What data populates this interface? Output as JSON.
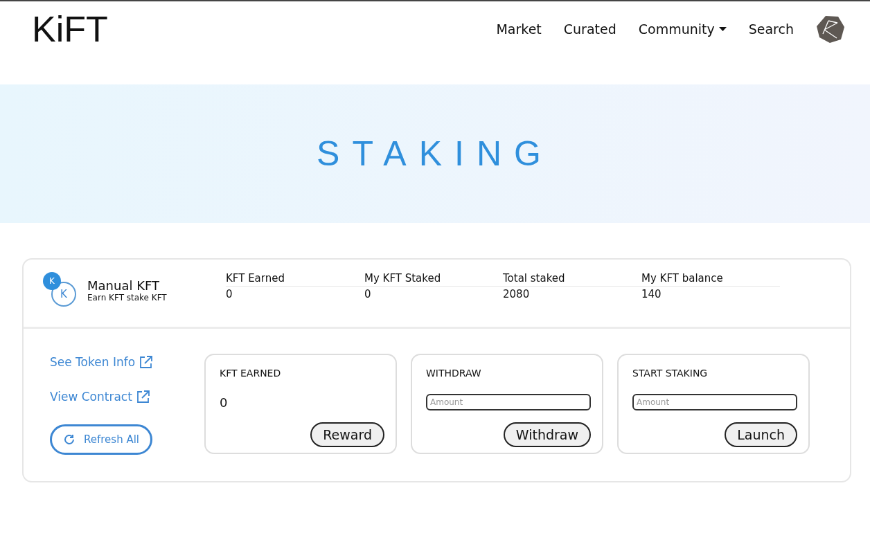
{
  "brand": "KiFT",
  "nav": [
    {
      "label": "Market",
      "dropdown": false
    },
    {
      "label": "Curated",
      "dropdown": false
    },
    {
      "label": "Community",
      "dropdown": true
    },
    {
      "label": "Search",
      "dropdown": false
    }
  ],
  "hero": {
    "title": "STAKING"
  },
  "pool": {
    "badge": "K",
    "token": "K",
    "name": "Manual KFT",
    "subtitle": "Earn KFT stake KFT",
    "stats": [
      {
        "label": "KFT Earned",
        "value": "0"
      },
      {
        "label": "My KFT Staked",
        "value": "0"
      },
      {
        "label": "Total staked",
        "value": "2080"
      },
      {
        "label": "My KFT balance",
        "value": "140"
      }
    ]
  },
  "links": [
    {
      "label": "See Token Info"
    },
    {
      "label": "View Contract"
    }
  ],
  "refresh_button": "Refresh All",
  "actions": [
    {
      "kind": "value",
      "title": "KFT EARNED",
      "value": "0",
      "button": "Reward"
    },
    {
      "kind": "input",
      "title": "WITHDRAW",
      "placeholder": "Amount",
      "button": "Withdraw"
    },
    {
      "kind": "input",
      "title": "START STAKING",
      "placeholder": "Amount",
      "button": "Launch"
    }
  ]
}
